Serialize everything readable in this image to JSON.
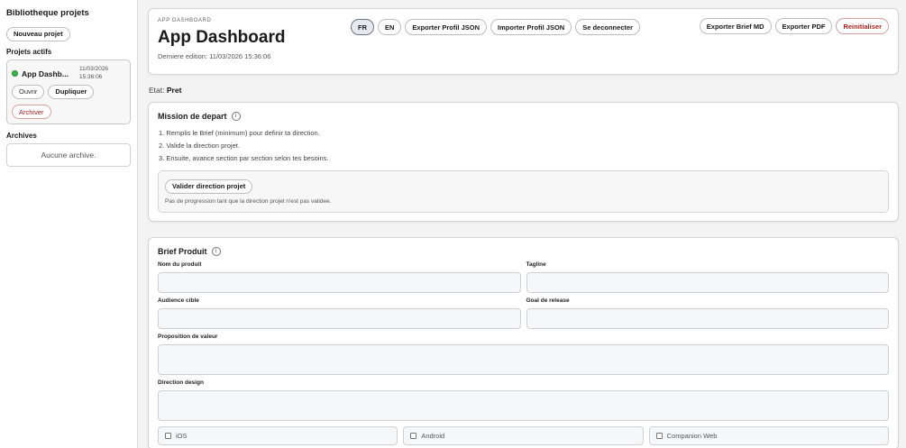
{
  "sidebar": {
    "title": "Bibliotheque projets",
    "new_project_label": "Nouveau projet",
    "active_section": "Projets actifs",
    "project": {
      "name": "App Dashb...",
      "date_line1": "11/03/2026",
      "date_line2": "15:36:06",
      "status_color": "#3bb54a",
      "open_label": "Ouvrir",
      "duplicate_label": "Dupliquer",
      "archive_label": "Archiver"
    },
    "archives_section": "Archives",
    "archives_empty": "Aucune archive."
  },
  "header": {
    "eyebrow": "APP DASHBOARD",
    "title": "App Dashboard",
    "last_edit": "Derniere edition: 11/03/2026 15:36:06",
    "lang_fr": "FR",
    "lang_en": "EN",
    "export_profile": "Exporter Profil JSON",
    "import_profile": "Importer Profil JSON",
    "logout": "Se deconnecter",
    "export_brief": "Exporter Brief MD",
    "export_pdf": "Exporter PDF",
    "reset": "Reinitialiser",
    "reset_color": "#b32020"
  },
  "state": {
    "label": "Etat:",
    "value": "Pret"
  },
  "mission": {
    "title": "Mission de depart",
    "steps": [
      "1. Remplis le Brief (minimum) pour definir ta direction.",
      "2. Valide la direction projet.",
      "3. Ensuite, avance section par section selon tes besoins."
    ],
    "validate_label": "Valider direction projet",
    "note": "Pas de progression tant que la direction projet n'est pas validee."
  },
  "brief": {
    "title": "Brief Produit",
    "product_name_label": "Nom du produit",
    "tagline_label": "Tagline",
    "audience_label": "Audience cible",
    "release_goal_label": "Goal de release",
    "value_prop_label": "Proposition de valeur",
    "design_direction_label": "Direction design",
    "platforms": [
      "iOS",
      "Android",
      "Companion Web"
    ]
  }
}
